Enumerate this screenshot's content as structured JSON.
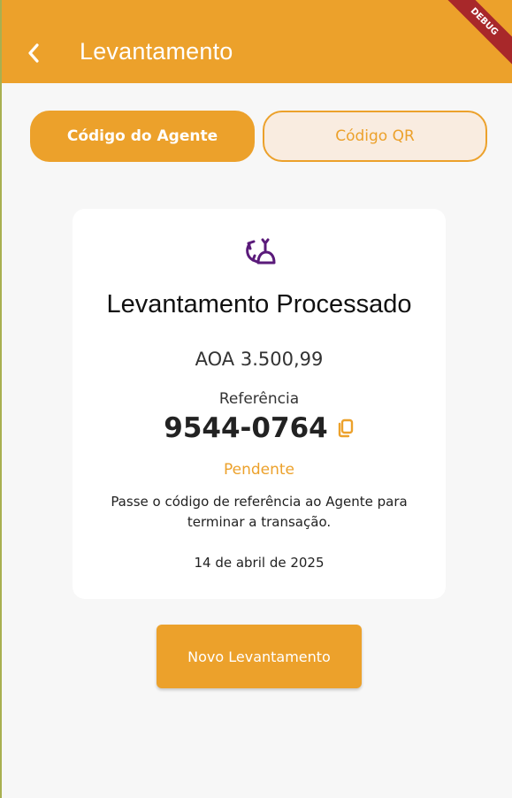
{
  "appbar": {
    "title": "Levantamento",
    "debug_label": "DEBUG"
  },
  "tabs": [
    {
      "label": "Código do Agente",
      "active": true
    },
    {
      "label": "Código QR",
      "active": false
    }
  ],
  "card": {
    "icon": "money-exchange-icon",
    "title": "Levantamento Processado",
    "amount": "AOA 3.500,99",
    "reference_label": "Referência",
    "reference_value": "9544-0764",
    "status": "Pendente",
    "message": "Passe o código de referência ao Agente para terminar a transação.",
    "date": "14 de abril de 2025"
  },
  "actions": {
    "new_button_label": "Novo Levantamento"
  },
  "colors": {
    "accent": "#eca12b",
    "icon_purple": "#5a1a7a",
    "debug_red": "#a8282a"
  }
}
